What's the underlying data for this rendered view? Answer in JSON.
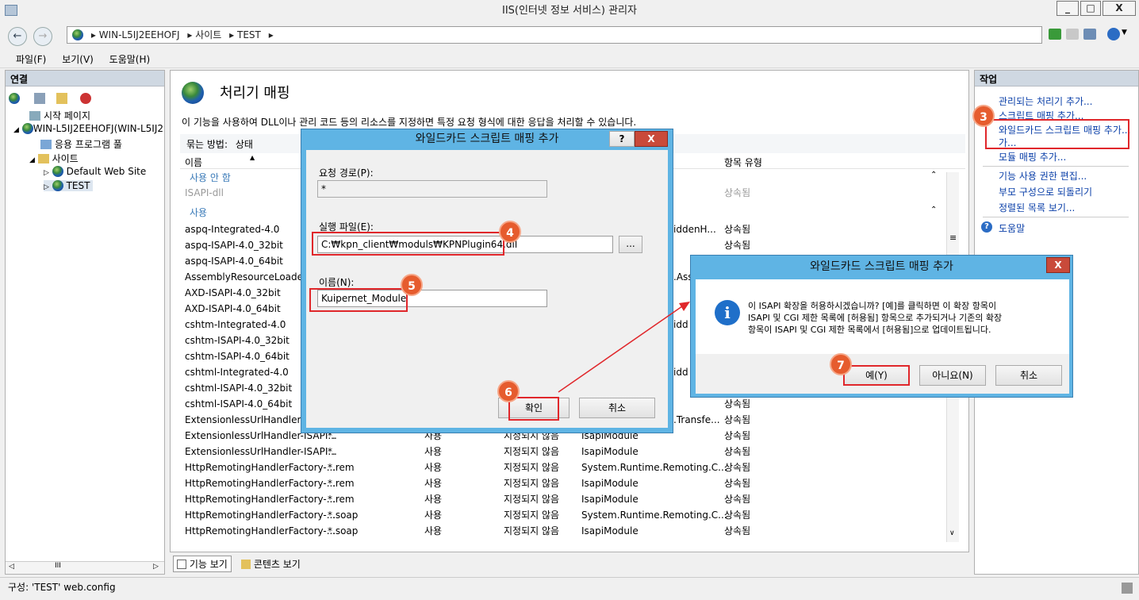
{
  "window": {
    "title": "IIS(인터넷 정보 서비스) 관리자",
    "min": "_",
    "max": "□",
    "close": "X"
  },
  "address": {
    "segments": [
      "WIN-L5IJ2EEHOFJ",
      "사이트",
      "TEST"
    ],
    "sep": "▸"
  },
  "menu": [
    "파일(F)",
    "보기(V)",
    "도움말(H)"
  ],
  "left": {
    "title": "연결",
    "tree": [
      "시작 페이지",
      "WIN-L5IJ2EEHOFJ(WIN-L5IJ2",
      "응용 프로그램 풀",
      "사이트",
      "Default Web Site",
      "TEST"
    ],
    "scroll_mark": "III"
  },
  "center": {
    "title": "처리기 매핑",
    "desc": "이 기능을 사용하여 DLL이나 관리 코드 등의 리소스를 지정하면 특정 요청 형식에 대한 응답을 처리할 수 있습니다.",
    "group_label": "묶는 방법:",
    "group_value": "상태",
    "col_name": "이름",
    "col_entry": "항목 유형",
    "group_disabled": "사용 안 함",
    "group_enabled": "사용",
    "disabled_rows": [
      {
        "name": "ISAPI-dll",
        "entry": "상속됨"
      }
    ],
    "rows_top": [
      {
        "name": "aspq-Integrated-4.0",
        "handler": "iddenH...",
        "entry": "상속됨"
      },
      {
        "name": "aspq-ISAPI-4.0_32bit",
        "handler": "",
        "entry": "상속됨"
      },
      {
        "name": "aspq-ISAPI-4.0_64bit",
        "handler": "",
        "entry": ""
      },
      {
        "name": "AssemblyResourceLoader-In",
        "handler": ".Ass",
        "entry": ""
      },
      {
        "name": "AXD-ISAPI-4.0_32bit",
        "handler": "",
        "entry": ""
      },
      {
        "name": "AXD-ISAPI-4.0_64bit",
        "handler": "",
        "entry": ""
      },
      {
        "name": "cshtm-Integrated-4.0",
        "handler": "idd",
        "entry": ""
      },
      {
        "name": "cshtm-ISAPI-4.0_32bit",
        "handler": "",
        "entry": ""
      },
      {
        "name": "cshtm-ISAPI-4.0_64bit",
        "handler": "",
        "entry": ""
      },
      {
        "name": "cshtml-Integrated-4.0",
        "handler": "idd",
        "entry": ""
      },
      {
        "name": "cshtml-ISAPI-4.0_32bit",
        "handler": "",
        "entry": ""
      },
      {
        "name": "cshtml-ISAPI-4.0_64bit",
        "handler": "",
        "entry": "상속됨"
      },
      {
        "name": "ExtensionlessUrlHandler-Int",
        "handler": ".Transfe...",
        "entry": "상속됨"
      }
    ],
    "rows_bottom": [
      {
        "name": "ExtensionlessUrlHandler-ISAPI...",
        "path": "*.",
        "state": "사용",
        "type": "지정되지 않음",
        "handler": "IsapiModule",
        "entry": "상속됨"
      },
      {
        "name": "ExtensionlessUrlHandler-ISAPI...",
        "path": "*.",
        "state": "사용",
        "type": "지정되지 않음",
        "handler": "IsapiModule",
        "entry": "상속됨"
      },
      {
        "name": "HttpRemotingHandlerFactory-...",
        "path": "*.rem",
        "state": "사용",
        "type": "지정되지 않음",
        "handler": "System.Runtime.Remoting.C...",
        "entry": "상속됨"
      },
      {
        "name": "HttpRemotingHandlerFactory-...",
        "path": "*.rem",
        "state": "사용",
        "type": "지정되지 않음",
        "handler": "IsapiModule",
        "entry": "상속됨"
      },
      {
        "name": "HttpRemotingHandlerFactory-...",
        "path": "*.rem",
        "state": "사용",
        "type": "지정되지 않음",
        "handler": "IsapiModule",
        "entry": "상속됨"
      },
      {
        "name": "HttpRemotingHandlerFactory-...",
        "path": "*.soap",
        "state": "사용",
        "type": "지정되지 않음",
        "handler": "System.Runtime.Remoting.C...",
        "entry": "상속됨"
      },
      {
        "name": "HttpRemotingHandlerFactory-...",
        "path": "*.soap",
        "state": "사용",
        "type": "지정되지 않음",
        "handler": "IsapiModule",
        "entry": "상속됨"
      }
    ],
    "tab_features": "기능 보기",
    "tab_content": "콘텐츠 보기"
  },
  "right": {
    "title": "작업",
    "links": [
      "관리되는 처리기 추가...",
      "스크립트 매핑 추가...",
      "와일드카드 스크립트 매핑 추가...",
      "모듈 매핑 추가..."
    ],
    "wildcard_line2": "가...",
    "links2": [
      "기능 사용 권한 편집...",
      "부모 구성으로 되돌리기",
      "정렬된 목록 보기..."
    ],
    "help": "도움말"
  },
  "dialog1": {
    "title": "와일드카드 스크립트 매핑 추가",
    "help_btn": "?",
    "close_btn": "X",
    "path_label": "요청 경로(P):",
    "path_value": "*",
    "exe_label": "실행 파일(E):",
    "exe_value": "C:₩kpn_client₩moduls₩KPNPlugin64.dll",
    "browse": "...",
    "name_label": "이름(N):",
    "name_value": "Kuipernet_Module",
    "ok": "확인",
    "cancel": "취소"
  },
  "dialog2": {
    "title": "와일드카드 스크립트 매핑 추가",
    "close_btn": "X",
    "info_icon": "i",
    "message": [
      "이 ISAPI 확장을 허용하시겠습니까? [예]를 클릭하면 이 확장 항목이",
      "ISAPI 및 CGI 제한 목록에 [허용됨] 항목으로 추가되거나 기존의 확장",
      "항목이 ISAPI 및 CGI 제한 목록에서 [허용됨]으로 업데이트됩니다."
    ],
    "yes": "예(Y)",
    "no": "아니요(N)",
    "cancel": "취소"
  },
  "badges": [
    "3",
    "4",
    "5",
    "6",
    "7"
  ],
  "status": "구성: 'TEST' web.config",
  "colors": {
    "accent": "#5fb4e4",
    "badge": "#e65c2e",
    "highlight": "#e0272b",
    "link": "#0a3fa8"
  }
}
